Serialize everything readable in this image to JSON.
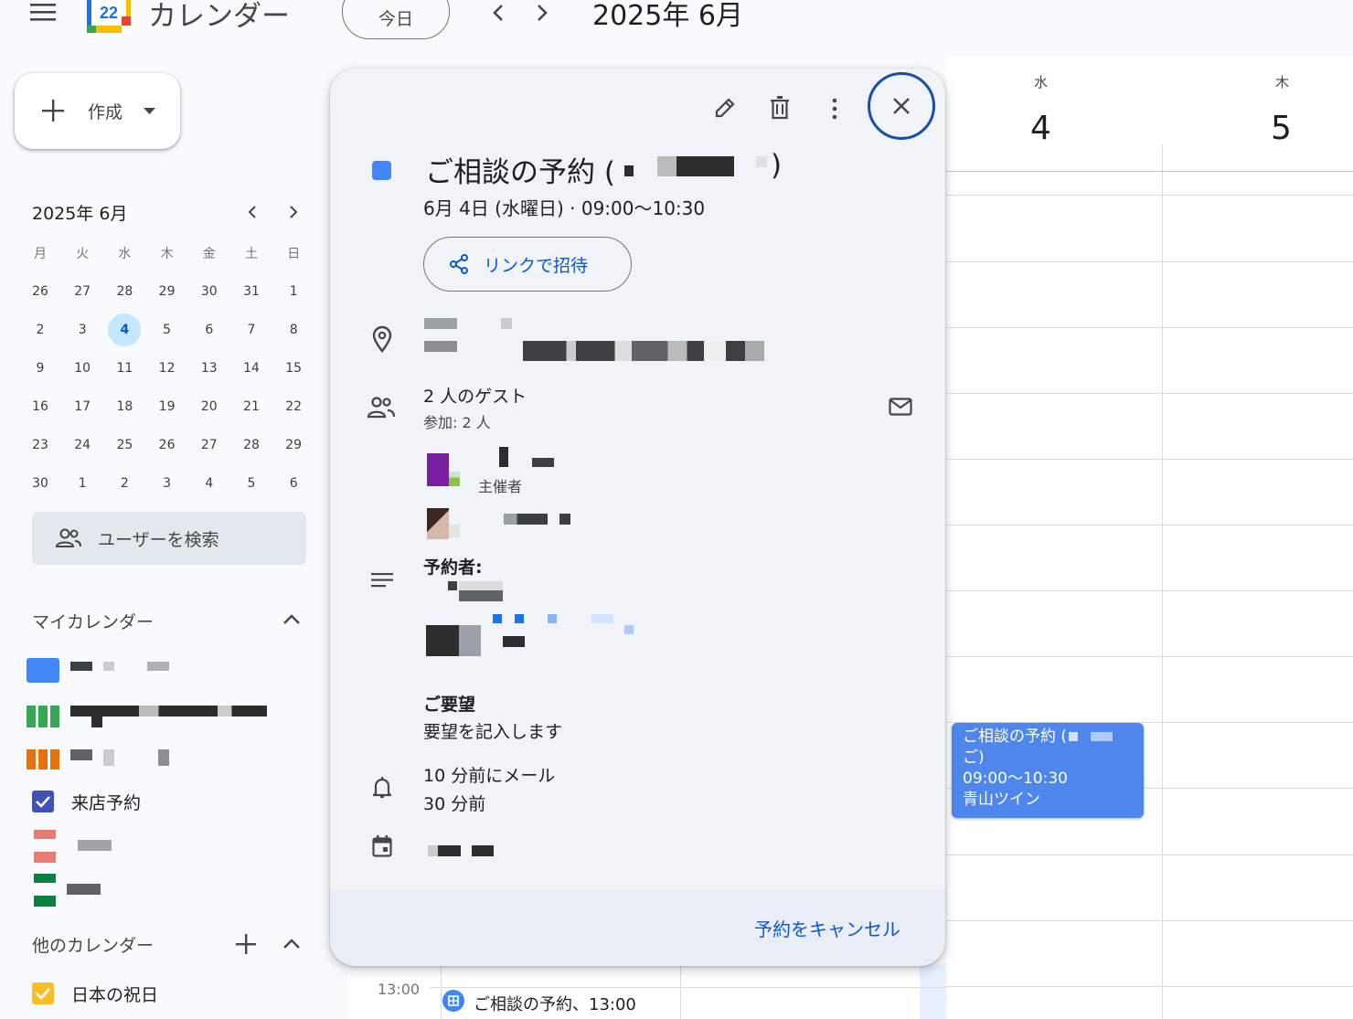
{
  "header": {
    "app_title": "カレンダー",
    "logo_day": "22",
    "today_label": "今日",
    "month_title": "2025年 6月"
  },
  "create": {
    "label": "作成"
  },
  "mini_calendar": {
    "title": "2025年 6月",
    "weekdays": [
      "月",
      "火",
      "水",
      "木",
      "金",
      "土",
      "日"
    ],
    "weeks": [
      [
        "26",
        "27",
        "28",
        "29",
        "30",
        "31",
        "1"
      ],
      [
        "2",
        "3",
        "4",
        "5",
        "6",
        "7",
        "8"
      ],
      [
        "9",
        "10",
        "11",
        "12",
        "13",
        "14",
        "15"
      ],
      [
        "16",
        "17",
        "18",
        "19",
        "20",
        "21",
        "22"
      ],
      [
        "23",
        "24",
        "25",
        "26",
        "27",
        "28",
        "29"
      ],
      [
        "30",
        "1",
        "2",
        "3",
        "4",
        "5",
        "6"
      ]
    ],
    "selected": "4"
  },
  "search_users": {
    "label": "ユーザーを検索"
  },
  "my_calendars": {
    "title": "マイカレンダー",
    "items": [
      {
        "label": "来店予約",
        "checked": true
      }
    ]
  },
  "other_calendars": {
    "title": "他のカレンダー",
    "items": [
      {
        "label": "日本の祝日",
        "checked": true
      }
    ]
  },
  "day_headers": [
    {
      "dow": "水",
      "date": "4"
    },
    {
      "dow": "木",
      "date": "5"
    }
  ],
  "grid_event": {
    "title": "ご相談の予約 (",
    "title_cont": "ご)",
    "time": "09:00〜10:30",
    "location": "青山ツイン",
    "color": "#4f86ec"
  },
  "popup": {
    "title": "ご相談の予約 (",
    "title_close": ")",
    "datetime": "6月 4日 (水曜日)  ·  09:00〜10:30",
    "invite_label": "リンクで招待",
    "guests_title": "2 人のゲスト",
    "guests_sub": "参加: 2 人",
    "organizer_label": "主催者",
    "booker_label": "予約者:",
    "request_label": "ご要望",
    "request_text": "要望を記入します",
    "reminder_1": "10 分前にメール",
    "reminder_2": "30 分前",
    "cancel_label": "予約をキャンセル",
    "calendar_color": "#4285f4"
  },
  "lower_strip": {
    "time": "13:00",
    "event": "ご相談の予約、13:00"
  }
}
